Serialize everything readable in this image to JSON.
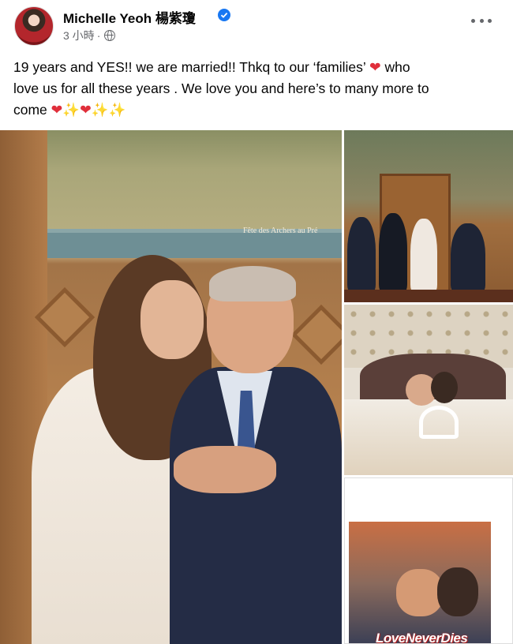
{
  "post": {
    "author": "Michelle Yeoh 楊紫瓊",
    "timestamp": "3 小時",
    "separator": "·",
    "verified_icon": "verified-badge-icon",
    "privacy_icon": "globe-icon",
    "menu_icon": "more-options-icon",
    "text_lines": [
      "19 years  and YES!! we are married!! Thkq to  our ‘families’ ",
      "who",
      "love us for all these years . We love you and here’s to many more to",
      "come"
    ],
    "emoji": {
      "heart": "❤",
      "sparkles": "✨"
    }
  },
  "photos": {
    "main_mural_caption": "Fête des Archers au Pré",
    "poster_title": "LoveNeverDies",
    "count": 4
  },
  "colors": {
    "verified_blue": "#1877f2",
    "heart_red": "#e02f3b",
    "sparkle_yellow": "#f7c325",
    "meta_gray": "#65676b"
  }
}
